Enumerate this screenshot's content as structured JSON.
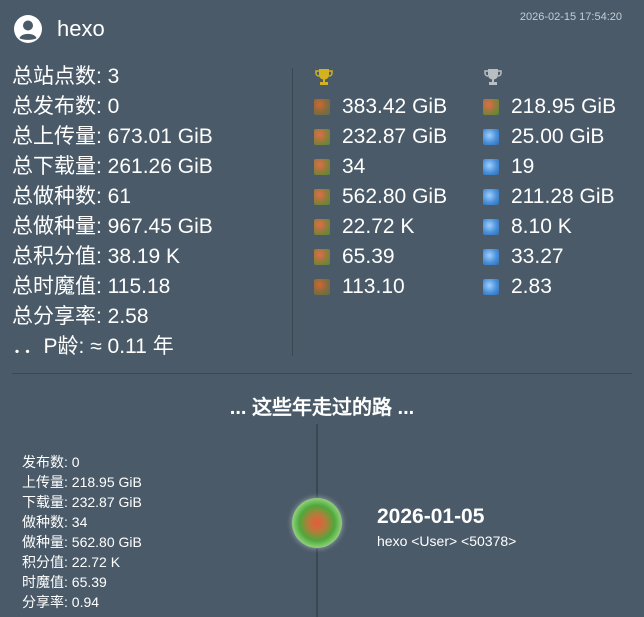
{
  "timestamp": "2026-02-15 17:54:20",
  "user": {
    "name": "hexo",
    "icon": "user-circle-icon"
  },
  "stats": [
    {
      "label": "总站点数",
      "value": "3"
    },
    {
      "label": "总发布数",
      "value": "0"
    },
    {
      "label": "总上传量",
      "value": "673.01 GiB"
    },
    {
      "label": "总下载量",
      "value": "261.26 GiB"
    },
    {
      "label": "总做种数",
      "value": "61"
    },
    {
      "label": "总做种量",
      "value": "967.45 GiB"
    },
    {
      "label": "总积分值",
      "value": "38.19 K"
    },
    {
      "label": "总时魔值",
      "value": "115.18"
    },
    {
      "label": "总分享率",
      "value": "2.58"
    },
    {
      "label": "．．P龄",
      "value": "≈ 0.11 年"
    }
  ],
  "top_column": {
    "trophy": "gold-trophy-icon",
    "trophy_color": "#d4b21e",
    "values": [
      "383.42 GiB",
      "232.87 GiB",
      "34",
      "562.80 GiB",
      "22.72 K",
      "65.39",
      "113.10"
    ]
  },
  "second_column": {
    "trophy": "silver-trophy-icon",
    "trophy_color": "#b9bec2",
    "values": [
      "218.95 GiB",
      "25.00 GiB",
      "19",
      "211.28 GiB",
      "8.10 K",
      "33.27",
      "2.83"
    ]
  },
  "timeline": {
    "title": "... 这些年走过的路 ...",
    "event": {
      "date": "2026-01-05",
      "user_line": "hexo <User> <50378>",
      "details": [
        {
          "label": "发布数",
          "value": "0"
        },
        {
          "label": "上传量",
          "value": "218.95 GiB"
        },
        {
          "label": "下载量",
          "value": "232.87 GiB"
        },
        {
          "label": "做种数",
          "value": "34"
        },
        {
          "label": "做种量",
          "value": "562.80 GiB"
        },
        {
          "label": "积分值",
          "value": "22.72 K"
        },
        {
          "label": "时魔值",
          "value": "65.39"
        },
        {
          "label": "分享率",
          "value": "0.94"
        }
      ]
    }
  }
}
